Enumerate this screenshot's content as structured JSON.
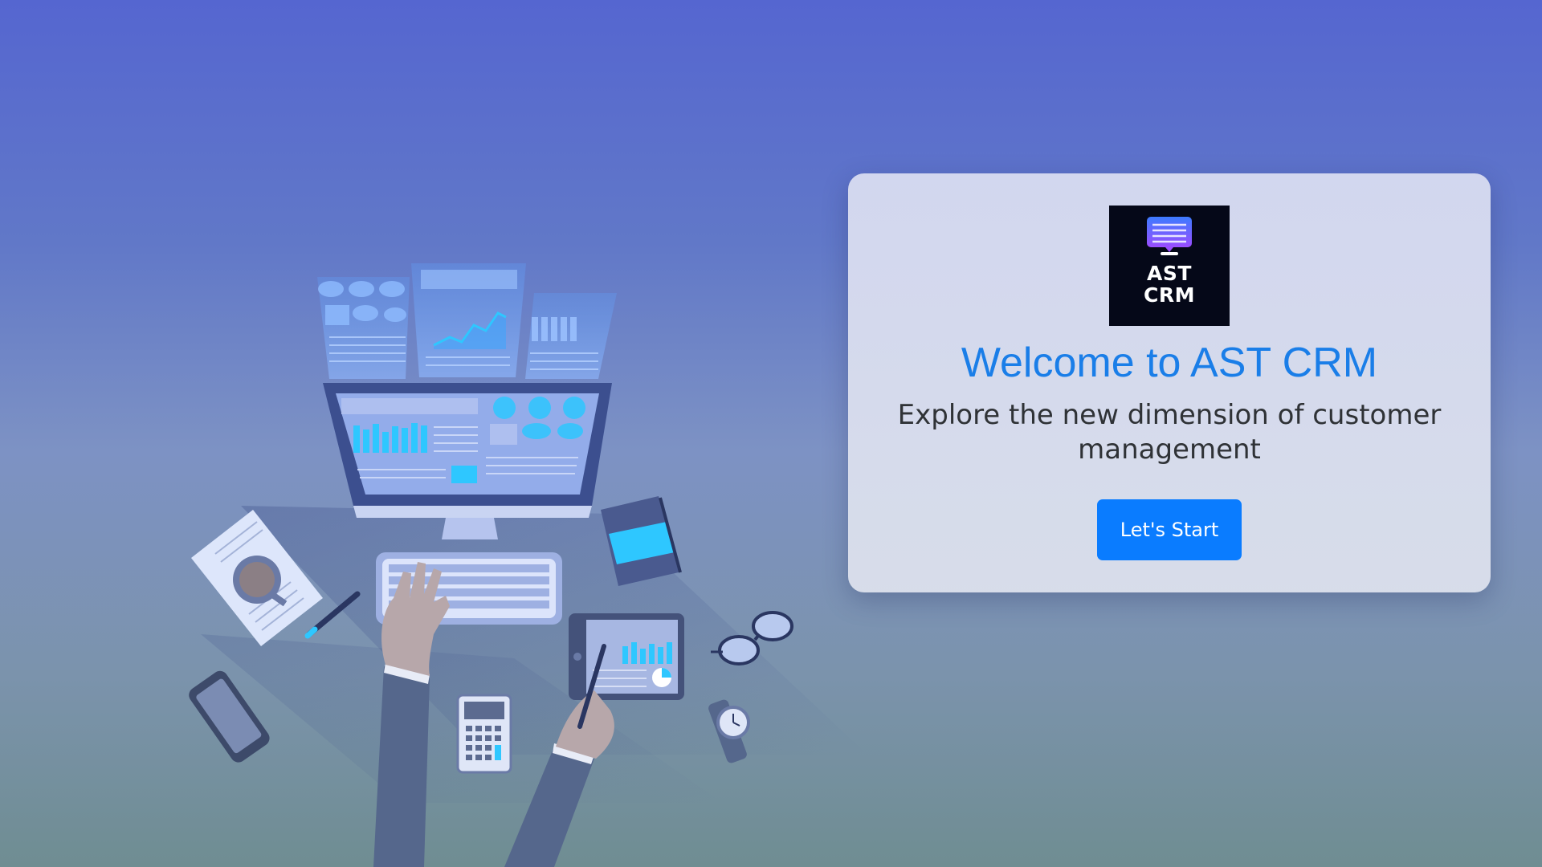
{
  "card": {
    "logo_line1": "AST",
    "logo_line2": "CRM",
    "title": "Welcome to AST CRM",
    "subtitle": "Explore the new dimension of customer management",
    "start_button_label": "Let's Start"
  },
  "icons": {
    "logo": "chat-bubble-icon",
    "illustration": "workspace-desk-illustration"
  },
  "colors": {
    "background_top": "#5566d0",
    "background_bottom": "#6f8d92",
    "accent": "#1a7ee8",
    "button": "#0a7cff",
    "logo_background": "#050818",
    "logo_bubble": "#7c4dff",
    "highlight_cyan": "#2ec7ff"
  }
}
